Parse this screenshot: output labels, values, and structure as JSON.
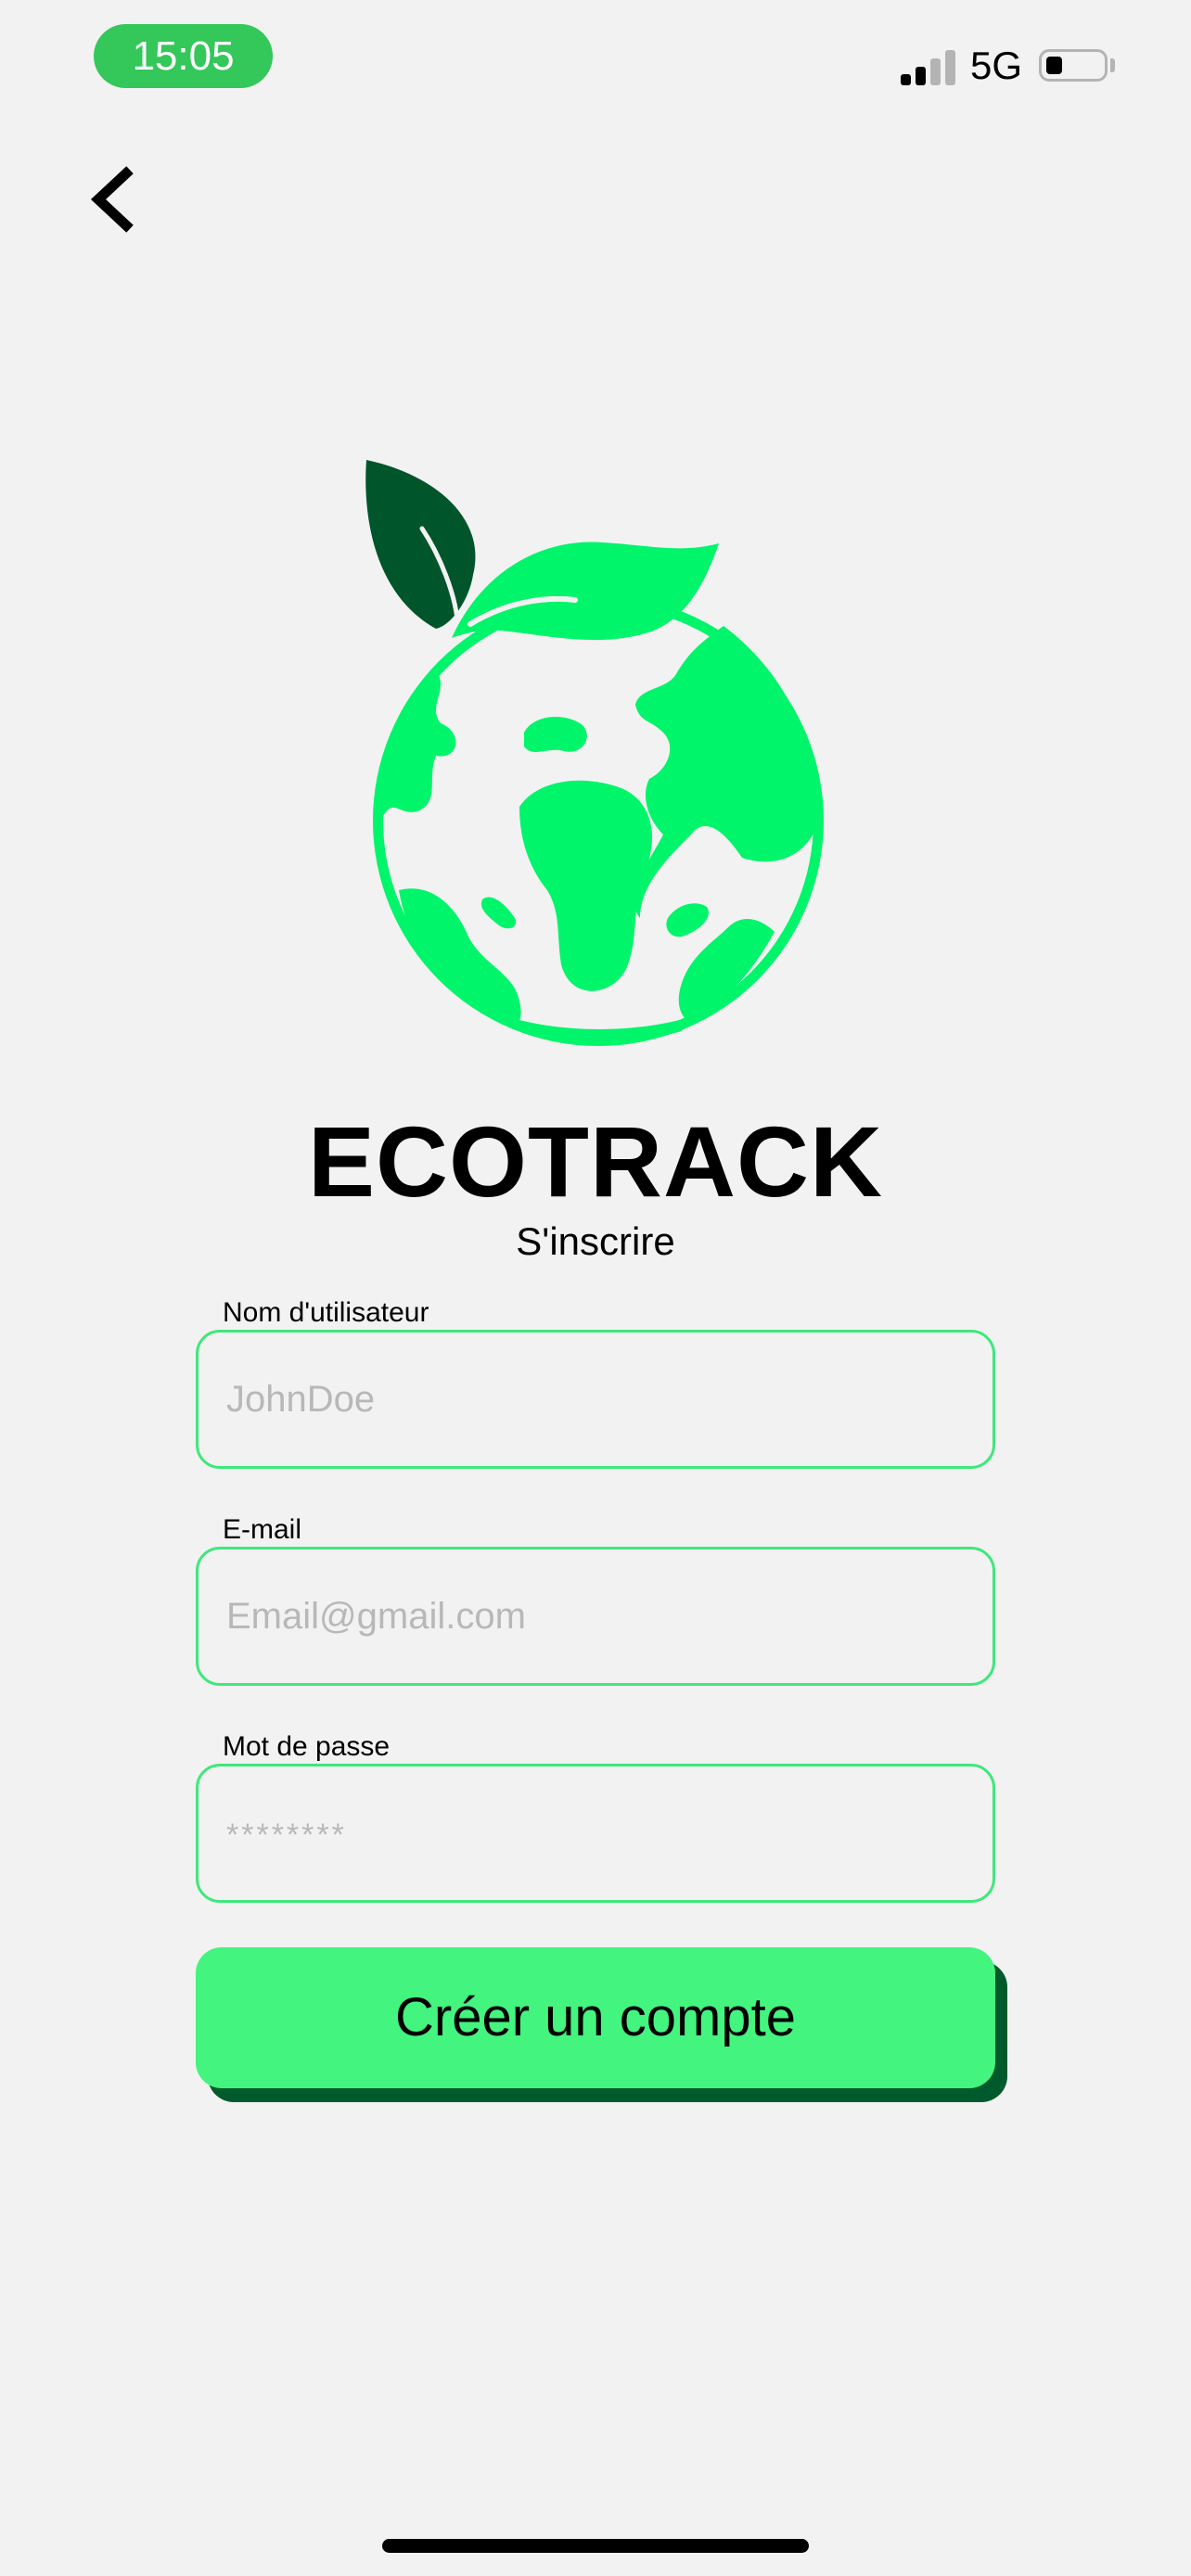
{
  "status_bar": {
    "time": "15:05",
    "network": "5G",
    "battery_level": 0.3,
    "signal_bars_active": 2,
    "signal_bars_total": 4
  },
  "icons": {
    "back": "chevron-left-icon",
    "logo": "earth-leaf-logo"
  },
  "colors": {
    "background": "#f2f2f2",
    "accent": "#43f47e",
    "accent_dark": "#005a2b",
    "status_pill": "#34c759",
    "field_border": "#3ee87a"
  },
  "header": {
    "title": "ECOTRACK",
    "subtitle": "S'inscrire"
  },
  "form": {
    "username": {
      "label": "Nom d'utilisateur",
      "value": "",
      "placeholder": "JohnDoe"
    },
    "email": {
      "label": "E-mail",
      "value": "",
      "placeholder": "Email@gmail.com"
    },
    "password": {
      "label": "Mot de passe",
      "value": "",
      "placeholder": "********"
    },
    "submit_label": "Créer un compte"
  }
}
